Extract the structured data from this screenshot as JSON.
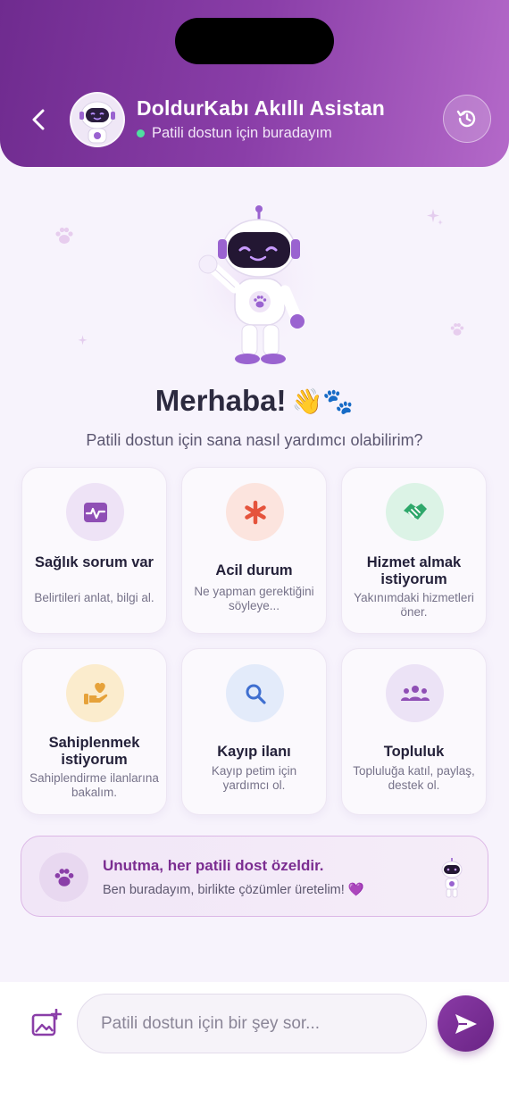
{
  "header": {
    "title": "DoldurKabı Akıllı Asistan",
    "status": "Patili dostun için buradayım",
    "back_icon": "chevron-left-icon",
    "history_icon": "history-icon",
    "status_color": "#4fe0a0"
  },
  "hero": {
    "greeting": "Merhaba!",
    "greeting_emoji": "👋🐾",
    "subtitle": "Patili dostun için sana nasıl yardımcı olabilirim?"
  },
  "cards": [
    {
      "title": "Sağlık sorum var",
      "desc": "Belirtileri anlat, bilgi al.",
      "icon": "health-pulse-icon",
      "color": "#8f4fb5",
      "bg": "#eee3f6"
    },
    {
      "title": "Acil durum",
      "desc": "Ne yapman gerektiğini söyleye...",
      "icon": "emergency-asterisk-icon",
      "color": "#e5533c",
      "bg": "#fce4de"
    },
    {
      "title": "Hizmet almak istiyorum",
      "desc": "Yakınımdaki hizmetleri öner.",
      "icon": "handshake-icon",
      "color": "#2fa86b",
      "bg": "#dcf3e6"
    },
    {
      "title": "Sahiplenmek istiyorum",
      "desc": "Sahiplendirme ilanlarına bakalım.",
      "icon": "adopt-heart-hand-icon",
      "color": "#e6a23a",
      "bg": "#fbeccd"
    },
    {
      "title": "Kayıp ilanı",
      "desc": "Kayıp petim için yardımcı ol.",
      "icon": "search-icon",
      "color": "#3f6fd0",
      "bg": "#e3ebfa"
    },
    {
      "title": "Topluluk",
      "desc": "Topluluğa katıl, paylaş, destek ol.",
      "icon": "community-users-icon",
      "color": "#8f4fb5",
      "bg": "#ece3f6"
    }
  ],
  "banner": {
    "title": "Unutma, her patili dost özeldir.",
    "text": "Ben buradayım, birlikte çözümler üretelim! 💜"
  },
  "composer": {
    "placeholder": "Patili dostun için bir şey sor...",
    "image_icon": "add-image-icon",
    "send_icon": "send-icon"
  }
}
